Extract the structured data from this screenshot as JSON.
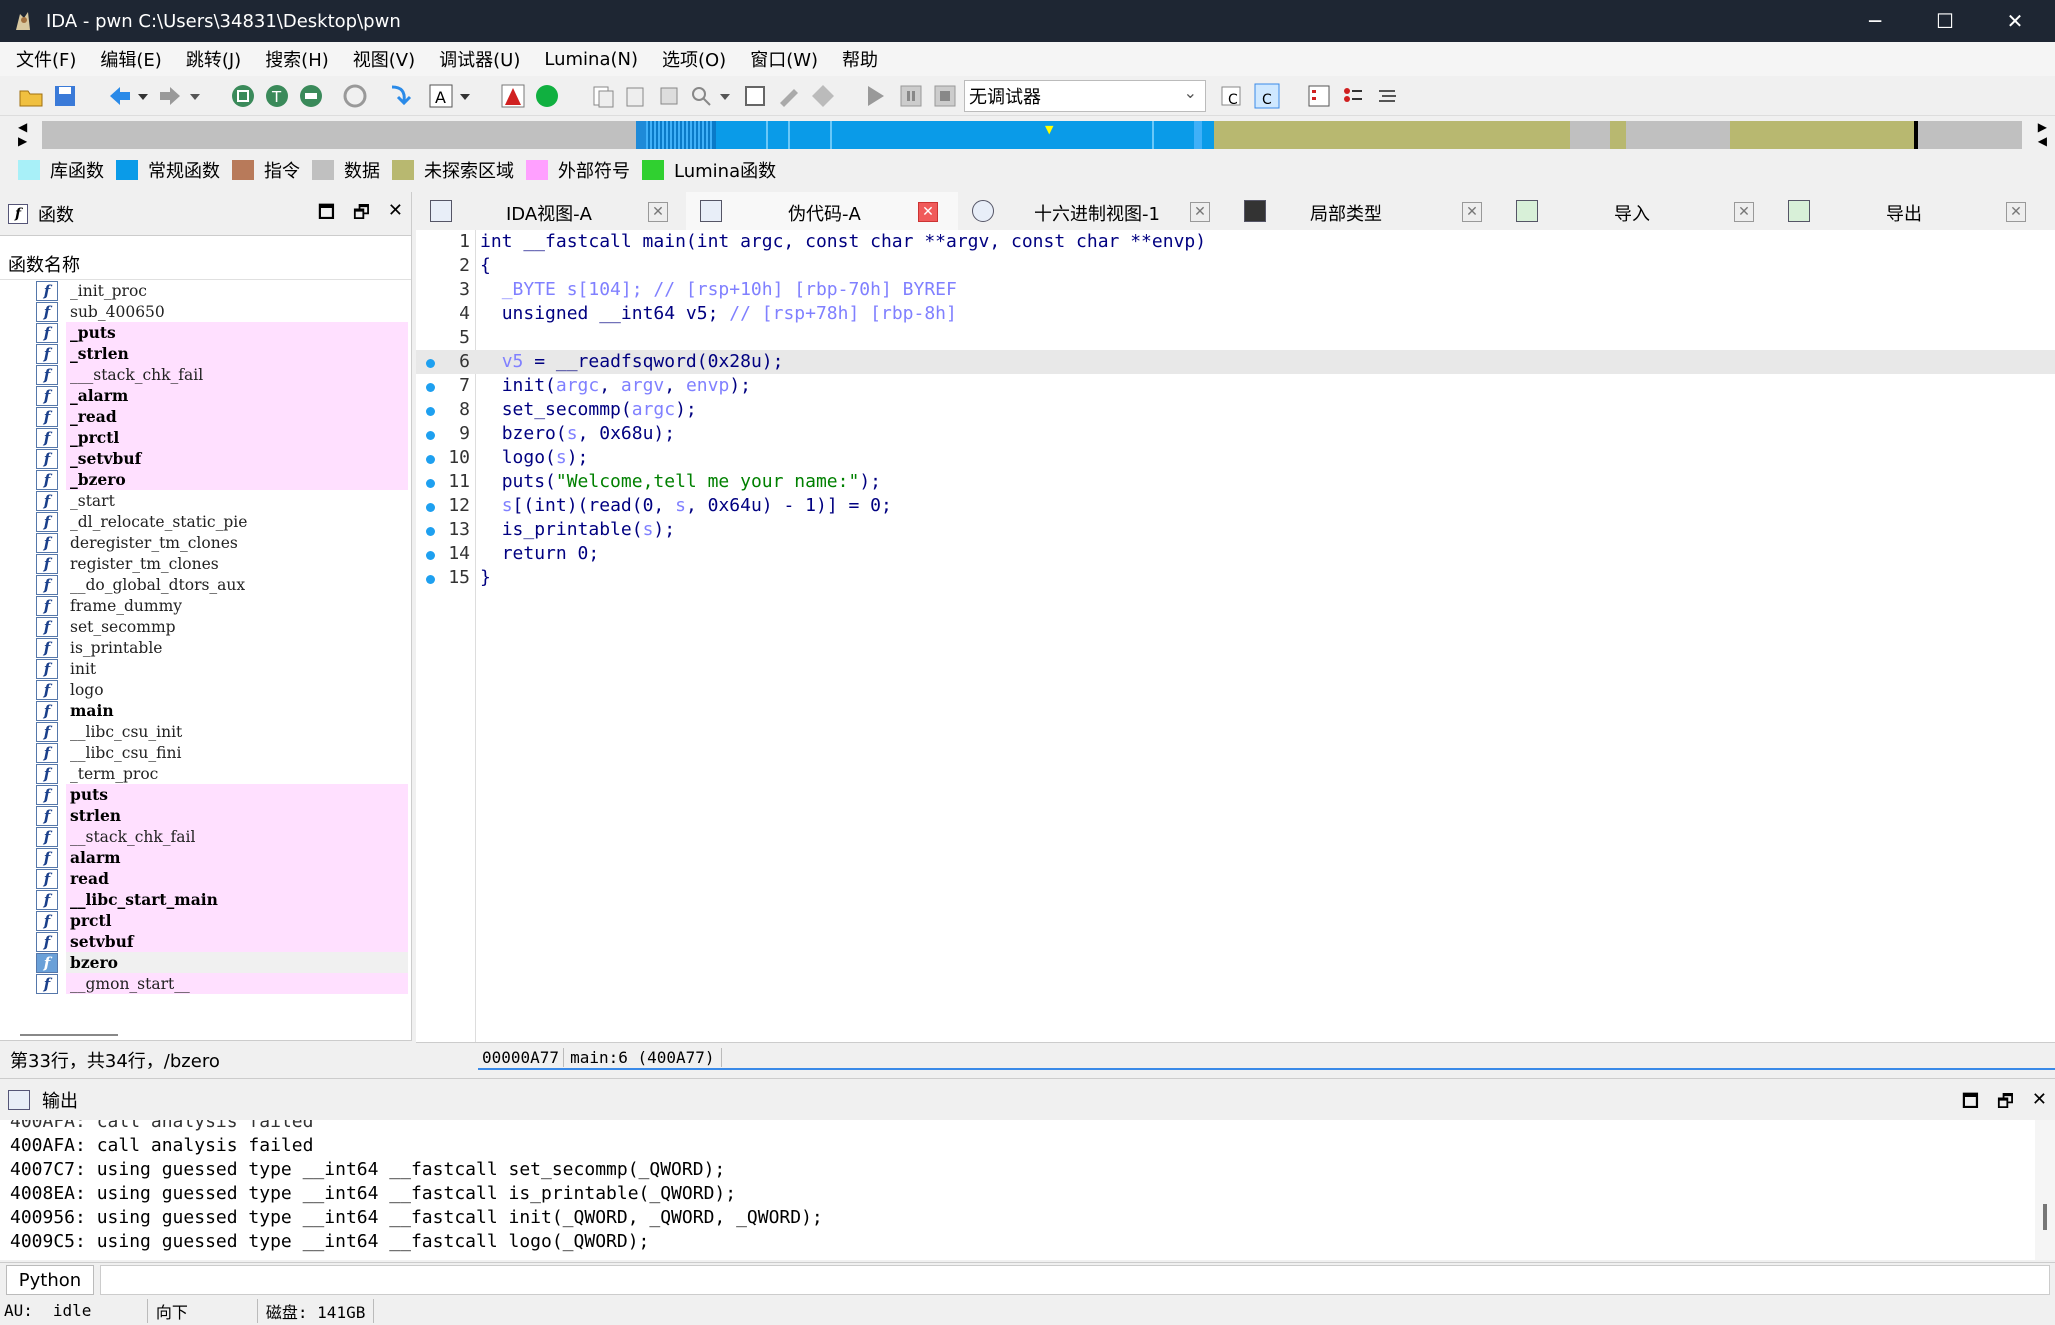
{
  "window": {
    "title": "IDA - pwn C:\\Users\\34831\\Desktop\\pwn",
    "minimize": "─",
    "maximize": "☐",
    "close": "✕"
  },
  "menu": [
    "文件(F)",
    "编辑(E)",
    "跳转(J)",
    "搜索(H)",
    "视图(V)",
    "调试器(U)",
    "Lumina(N)",
    "选项(O)",
    "窗口(W)",
    "帮助"
  ],
  "toolbar": {
    "debugger_select": "无调试器"
  },
  "legend": [
    {
      "label": "库函数",
      "color": "#a8f0f8"
    },
    {
      "label": "常规函数",
      "color": "#0a9be8"
    },
    {
      "label": "指令",
      "color": "#b87a5a"
    },
    {
      "label": "数据",
      "color": "#c0c0c0"
    },
    {
      "label": "未探索区域",
      "color": "#b8b870"
    },
    {
      "label": "外部符号",
      "color": "#ffa0ff"
    },
    {
      "label": "Lumina函数",
      "color": "#30d030"
    }
  ],
  "functions_panel": {
    "title": "函数",
    "column": "函数名称",
    "status": "第33行，共34行，/bzero",
    "items": [
      {
        "name": "_init_proc",
        "type": "normal"
      },
      {
        "name": "sub_400650",
        "type": "normal"
      },
      {
        "name": "_puts",
        "type": "import"
      },
      {
        "name": "_strlen",
        "type": "import"
      },
      {
        "name": "___stack_chk_fail",
        "type": "import_light"
      },
      {
        "name": "_alarm",
        "type": "import"
      },
      {
        "name": "_read",
        "type": "import"
      },
      {
        "name": "_prctl",
        "type": "import"
      },
      {
        "name": "_setvbuf",
        "type": "import"
      },
      {
        "name": "_bzero",
        "type": "import"
      },
      {
        "name": "_start",
        "type": "normal"
      },
      {
        "name": "_dl_relocate_static_pie",
        "type": "normal"
      },
      {
        "name": "deregister_tm_clones",
        "type": "normal"
      },
      {
        "name": "register_tm_clones",
        "type": "normal"
      },
      {
        "name": "__do_global_dtors_aux",
        "type": "normal"
      },
      {
        "name": "frame_dummy",
        "type": "normal"
      },
      {
        "name": "set_secommp",
        "type": "normal"
      },
      {
        "name": "is_printable",
        "type": "normal"
      },
      {
        "name": "init",
        "type": "normal"
      },
      {
        "name": "logo",
        "type": "normal"
      },
      {
        "name": "main",
        "type": "bold"
      },
      {
        "name": "__libc_csu_init",
        "type": "normal"
      },
      {
        "name": "__libc_csu_fini",
        "type": "normal"
      },
      {
        "name": "_term_proc",
        "type": "normal"
      },
      {
        "name": "puts",
        "type": "import"
      },
      {
        "name": "strlen",
        "type": "import"
      },
      {
        "name": "__stack_chk_fail",
        "type": "import_light"
      },
      {
        "name": "alarm",
        "type": "import"
      },
      {
        "name": "read",
        "type": "import"
      },
      {
        "name": "__libc_start_main",
        "type": "import"
      },
      {
        "name": "prctl",
        "type": "import"
      },
      {
        "name": "setvbuf",
        "type": "import"
      },
      {
        "name": "bzero",
        "type": "selected"
      },
      {
        "name": "__gmon_start__",
        "type": "import_light"
      }
    ]
  },
  "tabs": [
    {
      "label": "IDA视图-A"
    },
    {
      "label": "伪代码-A"
    },
    {
      "label": "十六进制视图-1"
    },
    {
      "label": "局部类型"
    },
    {
      "label": "导入"
    },
    {
      "label": "导出"
    }
  ],
  "code_lines": [
    "int __fastcall main(int argc, const char **argv, const char **envp)",
    "{",
    "  _BYTE s[104]; // [rsp+10h] [rbp-70h] BYREF",
    "  unsigned __int64 v5; // [rsp+78h] [rbp-8h]",
    "",
    "  v5 = __readfsqword(0x28u);",
    "  init(argc, argv, envp);",
    "  set_secommp(argc);",
    "  bzero(s, 0x68u);",
    "  logo(s);",
    "  puts(\"Welcome,tell me your name:\");",
    "  s[(int)(read(0, s, 0x64u) - 1)] = 0;",
    "  is_printable(s);",
    "  return 0;",
    "}"
  ],
  "code_status": {
    "addr": "00000A77",
    "loc": "main:6 (400A77)"
  },
  "output_panel": {
    "title": "输出",
    "lines": [
      "400AFA: call analysis failed",
      "4007C7: using guessed type __int64 __fastcall set_secommp(_QWORD);",
      "4008EA: using guessed type __int64 __fastcall is_printable(_QWORD);",
      "400956: using guessed type __int64 __fastcall init(_QWORD, _QWORD, _QWORD);",
      "4009C5: using guessed type __int64 __fastcall logo(_QWORD);"
    ]
  },
  "python_button": "Python",
  "statusbar": {
    "au": "AU:",
    "state": "idle",
    "direction": "向下",
    "disk": "磁盘: 141GB"
  }
}
